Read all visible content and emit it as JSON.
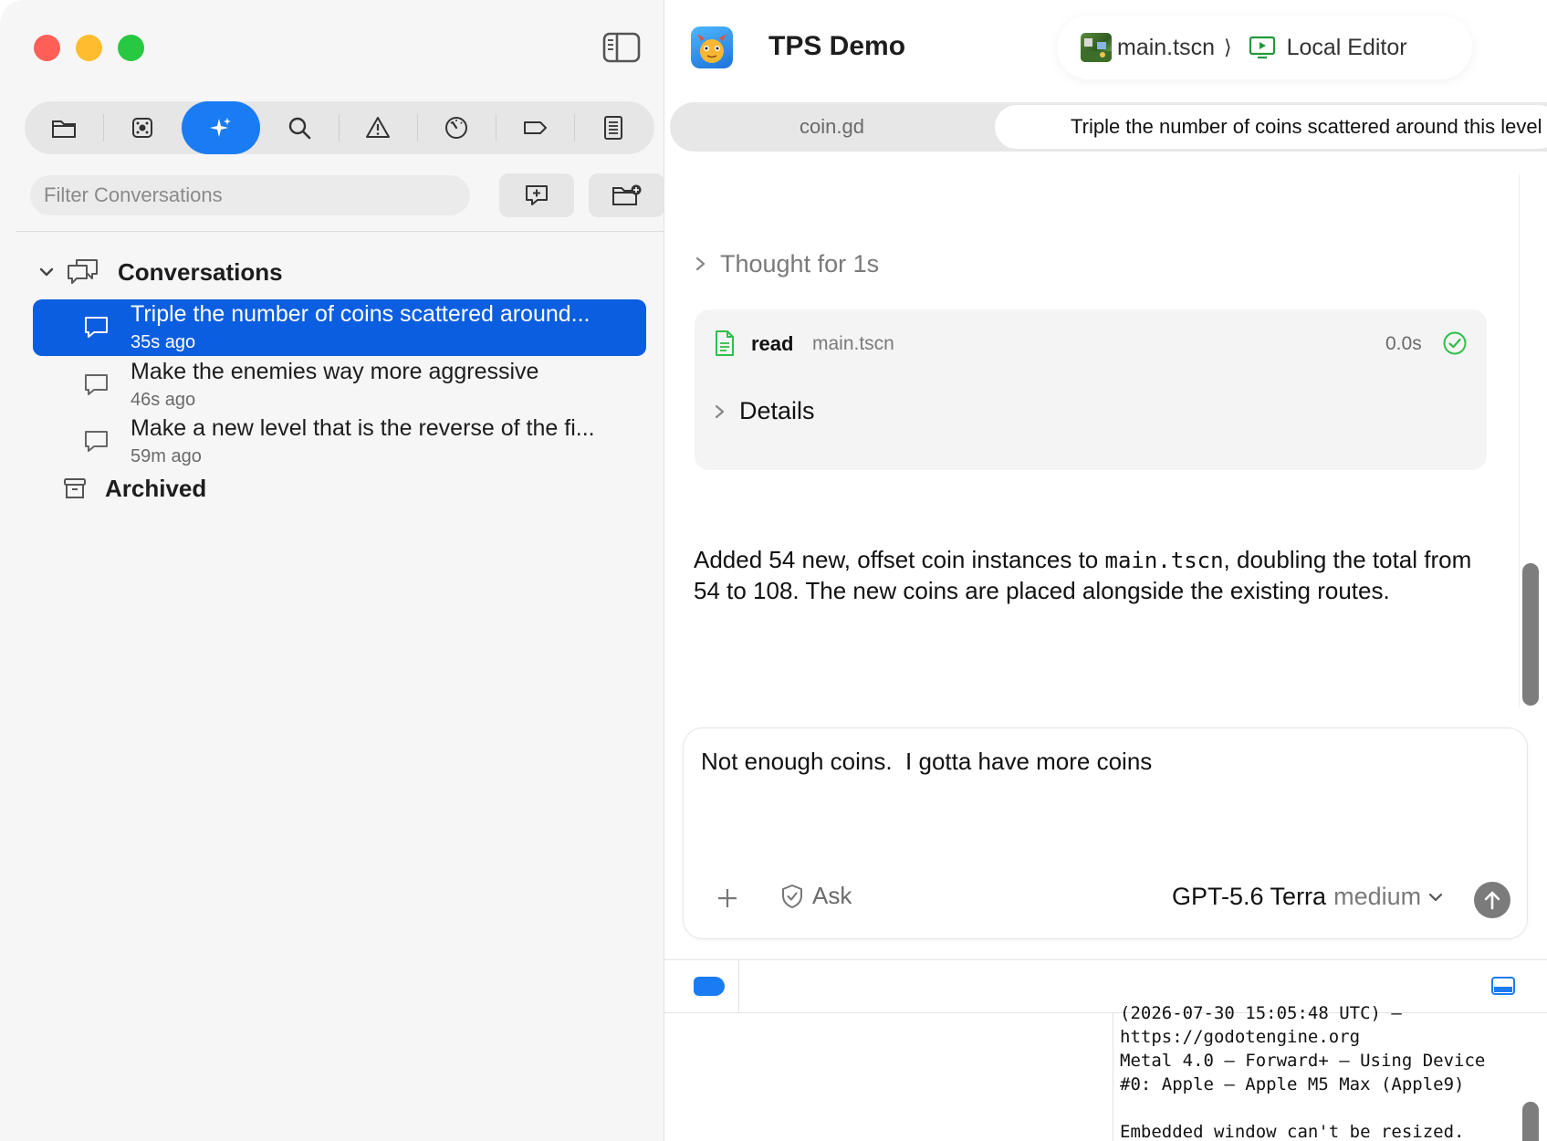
{
  "sidebar": {
    "toolbar_icons": [
      "folder-icon",
      "scene-icon",
      "sparkles-icon",
      "search-icon",
      "warning-icon",
      "debug-icon",
      "tag-icon",
      "report-icon"
    ],
    "filter": {
      "placeholder": "Filter Conversations",
      "value": ""
    },
    "conversations_label": "Conversations",
    "conversations": [
      {
        "title": "Triple the number of coins scattered around...",
        "time": "35s ago",
        "selected": true
      },
      {
        "title": "Make the enemies way more aggressive",
        "time": "46s ago",
        "selected": false
      },
      {
        "title": "Make a new level that is the reverse of the fi...",
        "time": "59m ago",
        "selected": false
      }
    ],
    "archived_label": "Archived"
  },
  "header": {
    "app_title": "TPS Demo",
    "scene_file": "main.tscn",
    "separator": "⟩",
    "editor_label": "Local Editor"
  },
  "tabs": [
    {
      "label": "coin.gd",
      "active": false
    },
    {
      "label": "Triple the number of coins scattered around this level",
      "active": true
    }
  ],
  "chat": {
    "thought_label": "Thought for 1s",
    "tool": {
      "action": "read",
      "file": "main.tscn",
      "duration": "0.0s",
      "status": "success"
    },
    "details_label": "Details",
    "reply": {
      "before": "Added 54 new, offset coin instances to ",
      "code": "main.tscn",
      "after": ", doubling the total from 54 to 108. The new coins are placed alongside the existing routes."
    }
  },
  "composer": {
    "value": "Not enough coins.  I gotta have more coins",
    "mode_label": "Ask",
    "model_name": "GPT-5.6 Terra",
    "model_effort": "medium"
  },
  "console": {
    "lines": [
      "(2026-07-30 15:05:48 UTC) –",
      "https://godotengine.org",
      "Metal 4.0 – Forward+ – Using Device",
      "#0: Apple – Apple M5 Max (Apple9)",
      "",
      "Embedded window can't be resized."
    ]
  },
  "colors": {
    "accent": "#1a7cf2",
    "selection": "#0b5ee0",
    "close": "#ff5f57",
    "minimize": "#febc2e",
    "maximize": "#28c840",
    "success": "#2fbf4a"
  }
}
